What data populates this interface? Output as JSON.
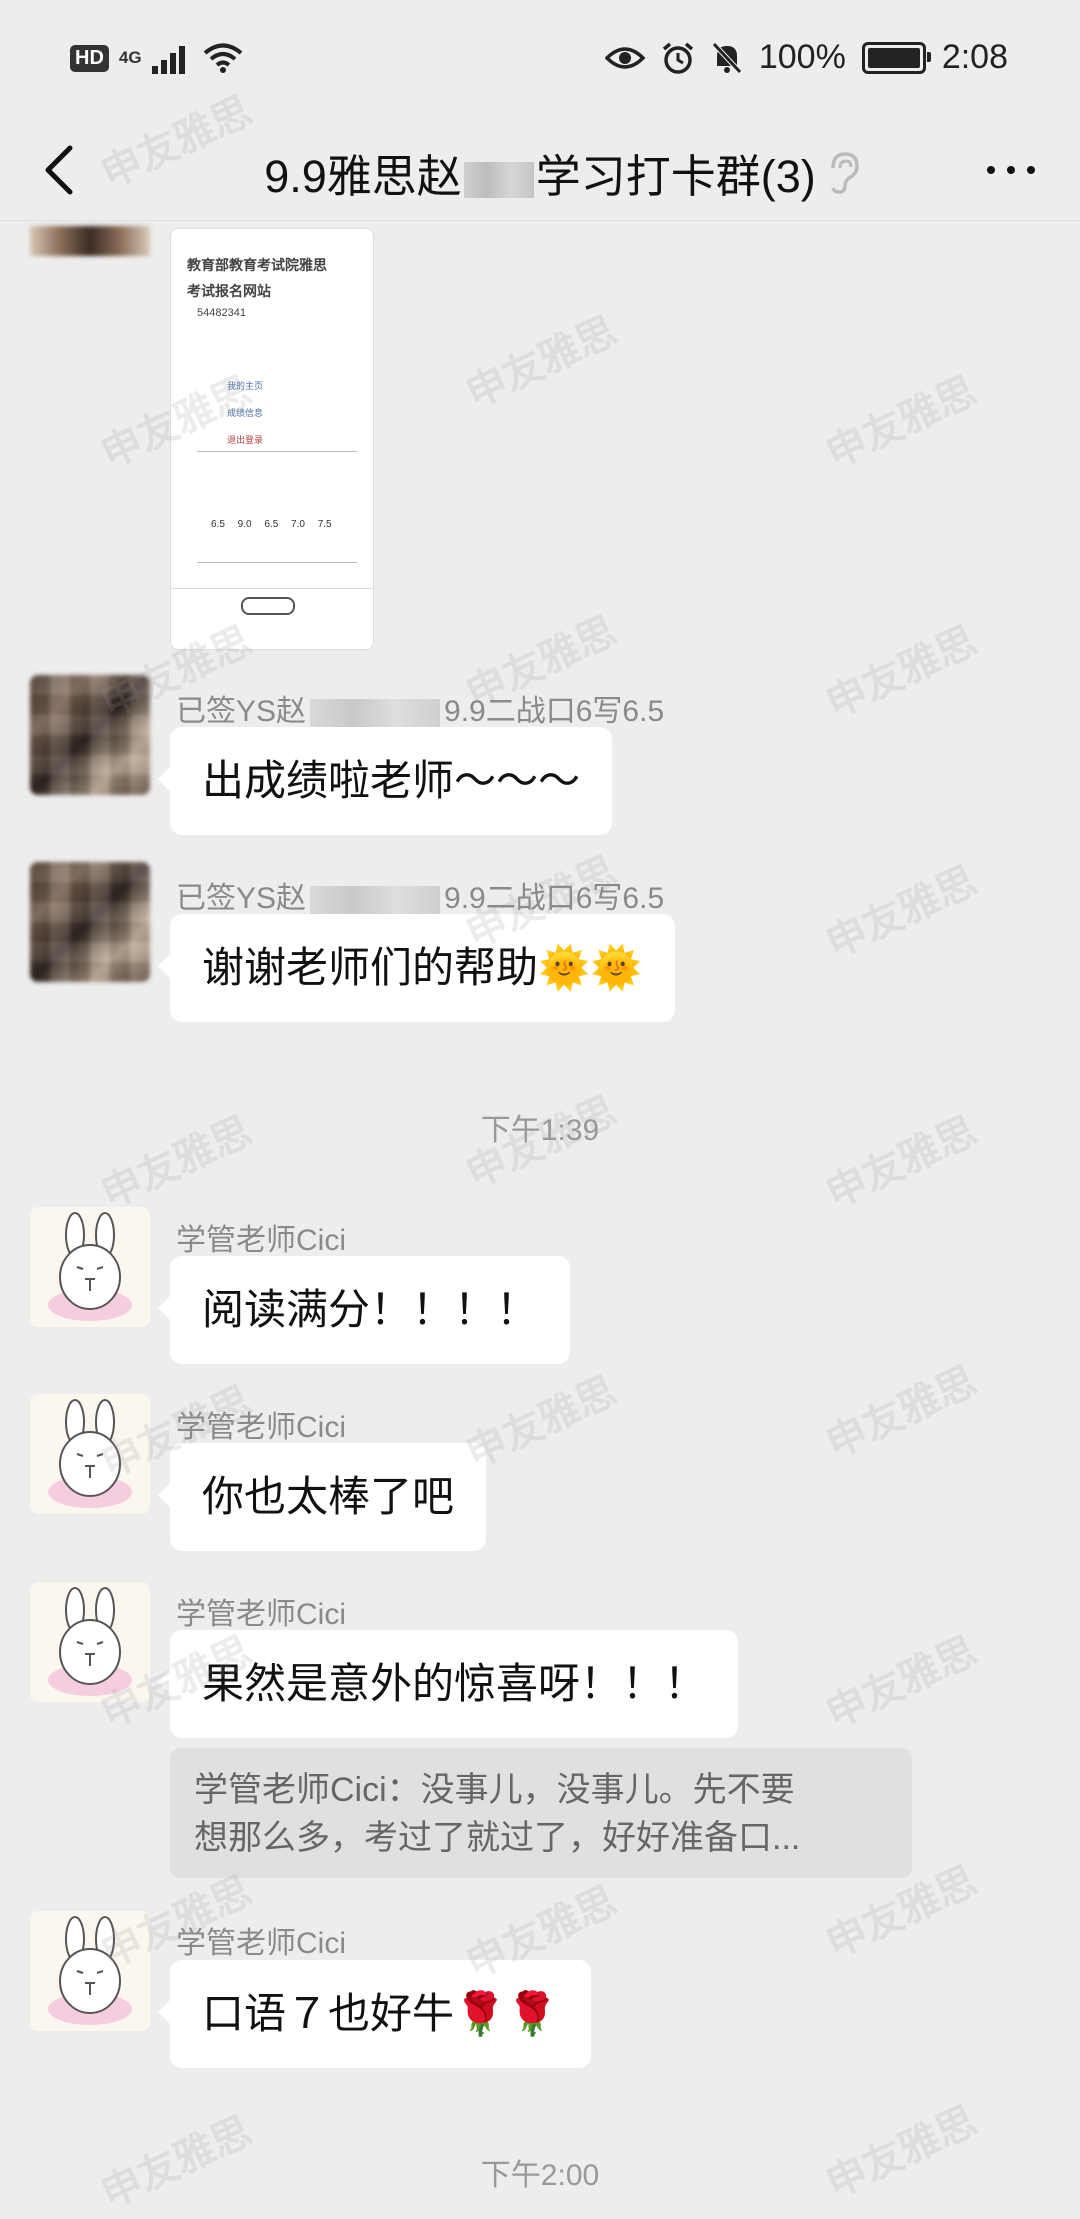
{
  "status_bar": {
    "hd": "HD",
    "network": "4G",
    "battery_percent": "100%",
    "time": "2:08"
  },
  "header": {
    "title_prefix": "9.9雅思赵",
    "title_suffix": "学习打卡群(3)",
    "icons": [
      "back-arrow-icon",
      "ear-icon",
      "more-icon"
    ]
  },
  "image_message": {
    "line1": "教育部教育考试院雅思",
    "line2": "考试报名网站",
    "number": "54482341",
    "links": [
      "我的主页",
      "成绩信息",
      "退出登录"
    ],
    "scores": "6.5 9.0 6.5 7.0 7.5"
  },
  "messages": [
    {
      "sender_prefix": "已签YS赵",
      "sender_suffix": "9.9二战口6写6.5",
      "text": "出成绩啦老师～～～"
    },
    {
      "sender_prefix": "已签YS赵",
      "sender_suffix": "9.9二战口6写6.5",
      "text": "谢谢老师们的帮助🌞🌞"
    },
    {
      "sender": "学管老师Cici",
      "text": "阅读满分！！！！"
    },
    {
      "sender": "学管老师Cici",
      "text": "你也太棒了吧"
    },
    {
      "sender": "学管老师Cici",
      "text": "果然是意外的惊喜呀！！！"
    },
    {
      "sender": "学管老师Cici",
      "text": "口语７也好牛🌹🌹"
    }
  ],
  "quote": {
    "line1": "学管老师Cici：没事儿，没事儿。先不要",
    "line2": "想那么多，考过了就过了，好好准备口..."
  },
  "timestamps": [
    "下午1:39",
    "下午2:00"
  ],
  "watermark": "申友雅思"
}
